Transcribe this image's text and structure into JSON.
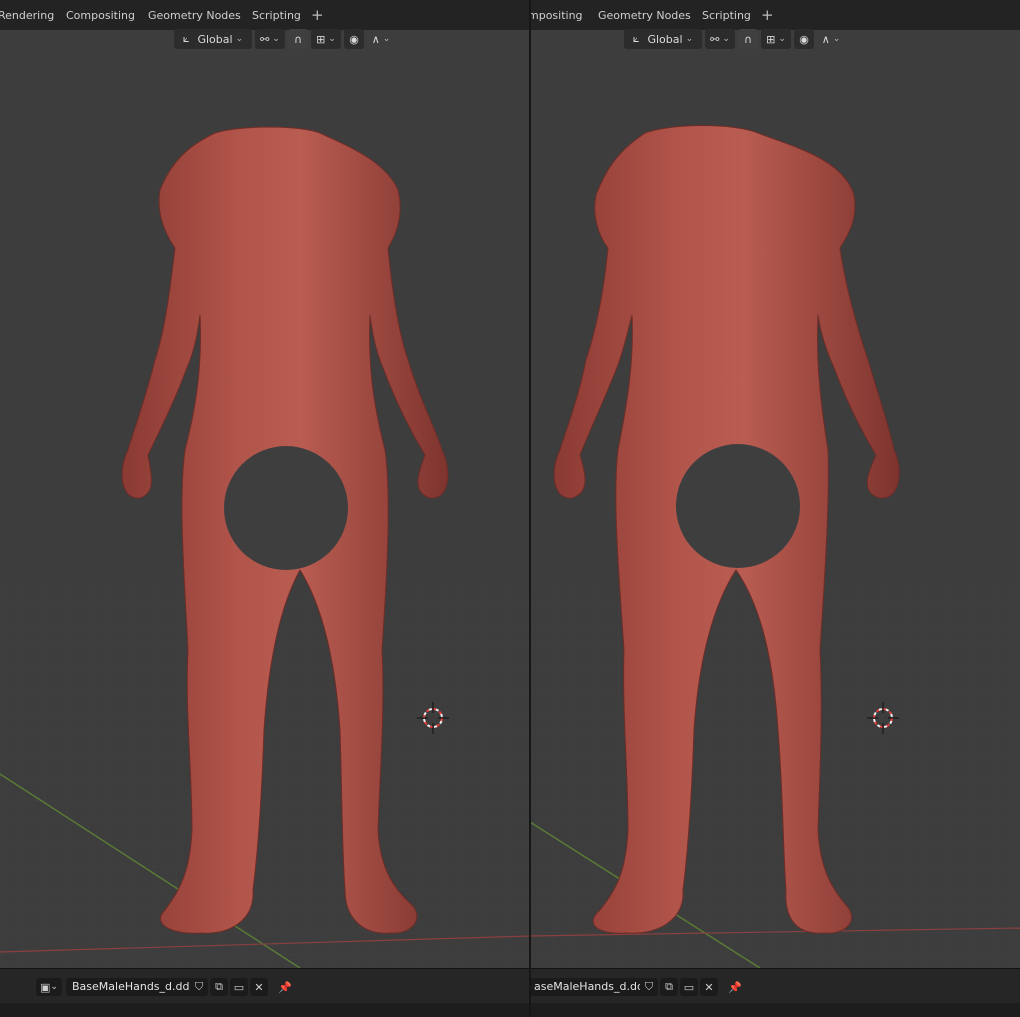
{
  "left_pane": {
    "workspace_tabs": [
      "Rendering",
      "Compositing",
      "Geometry Nodes",
      "Scripting"
    ],
    "add_tab": "+",
    "header": {
      "orientation": "Global"
    },
    "image_editor": {
      "filename": "BaseMaleHands_d.dds"
    }
  },
  "right_pane": {
    "workspace_tabs": [
      "mpositing",
      "Geometry Nodes",
      "Scripting"
    ],
    "add_tab": "+",
    "header": {
      "orientation": "Global"
    },
    "image_editor": {
      "filename": "aseMaleHands_d.dds"
    }
  },
  "icons": {
    "header": [
      "transform-orientation-icon",
      "pivot-point-icon",
      "snap-icon",
      "snap-increment-icon",
      "proportional-editing-icon",
      "falloff-curve-icon"
    ],
    "viewport": [
      "3d-cursor-icon"
    ],
    "image_editor": [
      "image-editor-type-icon",
      "fake-user-shield-icon",
      "new-image-icon",
      "open-folder-icon",
      "unlink-x-icon",
      "pin-icon"
    ]
  },
  "colors": {
    "top_bar": "#232323",
    "viewport_background": "#3d3d3d",
    "grid_line": "#474747",
    "x_axis": "#8a4040",
    "y_axis": "#5a7a36",
    "model_skin": "#a84a40",
    "censor_disc": "#3e3e3e",
    "cursor_red": "#e53b3b"
  },
  "viewport_note_visible_text": ""
}
